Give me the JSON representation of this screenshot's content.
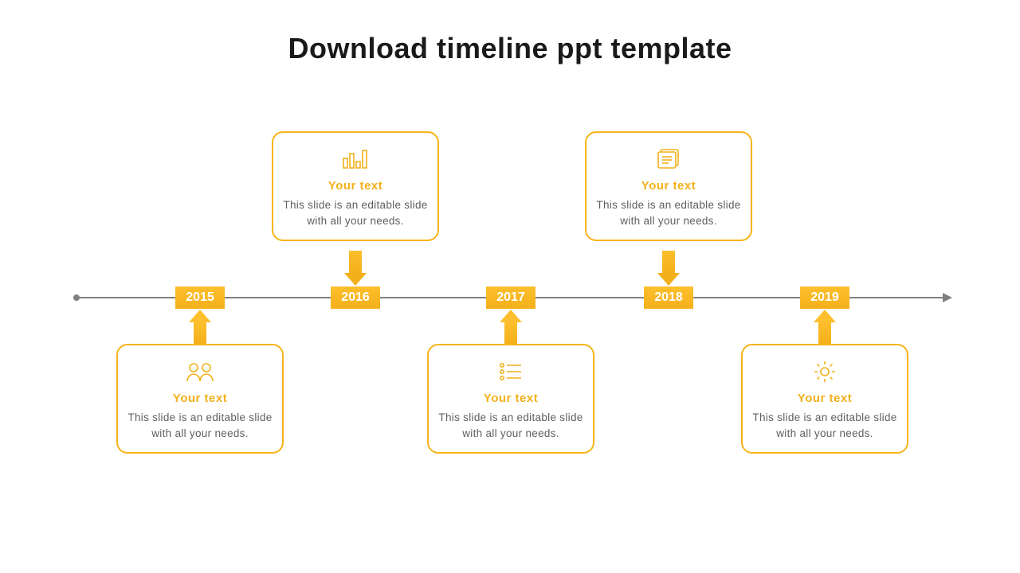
{
  "title": "Download timeline ppt template",
  "colors": {
    "accent": "#f7b41a",
    "axis": "#808080",
    "text": "#5f5f5f"
  },
  "timeline": {
    "years": [
      "2015",
      "2016",
      "2017",
      "2018",
      "2019"
    ],
    "cards": [
      {
        "position": "below",
        "icon": "people-icon",
        "heading": "Your text",
        "body": "This slide is an editable slide with all your needs."
      },
      {
        "position": "above",
        "icon": "bar-chart-icon",
        "heading": "Your text",
        "body": "This slide is an editable slide with all your needs."
      },
      {
        "position": "below",
        "icon": "list-icon",
        "heading": "Your text",
        "body": "This slide is an editable slide with all your needs."
      },
      {
        "position": "above",
        "icon": "document-icon",
        "heading": "Your text",
        "body": "This slide is an editable slide with all your needs."
      },
      {
        "position": "below",
        "icon": "gear-icon",
        "heading": "Your text",
        "body": "This slide is an editable slide with all your needs."
      }
    ]
  }
}
